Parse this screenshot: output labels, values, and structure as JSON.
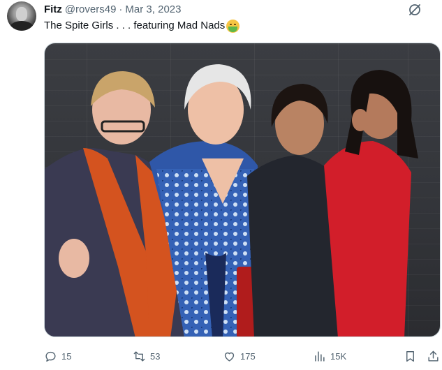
{
  "tweet": {
    "display_name": "Fitz",
    "handle": "@rovers49",
    "separator": "·",
    "date": "Mar 3, 2023",
    "text": "The Spite Girls . . . featuring Mad Nads",
    "emoji_icon": "nauseated-face-icon"
  },
  "actions": {
    "replies": "15",
    "retweets": "53",
    "likes": "175",
    "views": "15K"
  },
  "colors": {
    "muted": "#536471",
    "text": "#0f1419",
    "border": "#cfd9de"
  }
}
